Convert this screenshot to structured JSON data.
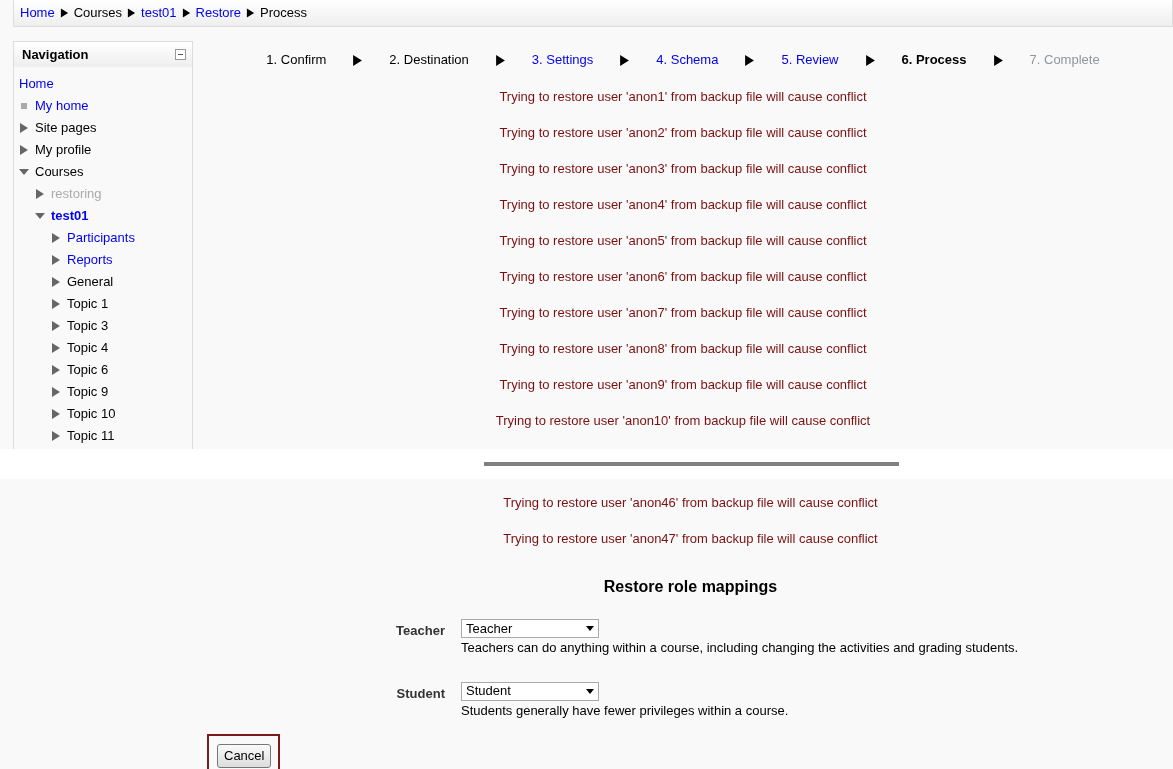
{
  "breadcrumb": [
    {
      "label": "Home",
      "link": true
    },
    {
      "label": "Courses",
      "link": false
    },
    {
      "label": "test01",
      "link": true
    },
    {
      "label": "Restore",
      "link": true
    },
    {
      "label": "Process",
      "link": false
    }
  ],
  "navigation": {
    "title": "Navigation",
    "items": [
      {
        "label": "Home",
        "kind": "none",
        "link": true
      },
      {
        "label": "My home",
        "kind": "bullet",
        "link": true
      },
      {
        "label": "Site pages",
        "kind": "branch",
        "link": false,
        "expanded": false
      },
      {
        "label": "My profile",
        "kind": "branch",
        "link": false,
        "expanded": false
      },
      {
        "label": "Courses",
        "kind": "branch",
        "link": false,
        "expanded": true,
        "children": [
          {
            "label": "restoring",
            "kind": "branch",
            "link": false,
            "disabled": true,
            "expanded": false
          },
          {
            "label": "test01",
            "kind": "branch",
            "link": true,
            "selected": true,
            "expanded": true,
            "children": [
              {
                "label": "Participants",
                "kind": "branch",
                "link": true,
                "expanded": false
              },
              {
                "label": "Reports",
                "kind": "branch",
                "link": true,
                "expanded": false
              },
              {
                "label": "General",
                "kind": "branch",
                "link": false,
                "expanded": false
              },
              {
                "label": "Topic 1",
                "kind": "branch",
                "link": false,
                "expanded": false
              },
              {
                "label": "Topic 3",
                "kind": "branch",
                "link": false,
                "expanded": false
              },
              {
                "label": "Topic 4",
                "kind": "branch",
                "link": false,
                "expanded": false
              },
              {
                "label": "Topic 6",
                "kind": "branch",
                "link": false,
                "expanded": false
              },
              {
                "label": "Topic 9",
                "kind": "branch",
                "link": false,
                "expanded": false
              },
              {
                "label": "Topic 10",
                "kind": "branch",
                "link": false,
                "expanded": false
              },
              {
                "label": "Topic 11",
                "kind": "branch",
                "link": false,
                "expanded": false
              }
            ]
          }
        ]
      }
    ]
  },
  "steps": [
    {
      "label": "1. Confirm",
      "kind": "done"
    },
    {
      "label": "2. Destination",
      "kind": "done"
    },
    {
      "label": "3. Settings",
      "kind": "link"
    },
    {
      "label": "4. Schema",
      "kind": "link"
    },
    {
      "label": "5. Review",
      "kind": "link"
    },
    {
      "label": "6. Process",
      "kind": "current"
    },
    {
      "label": "7. Complete",
      "kind": "future"
    }
  ],
  "messages_top": [
    "Trying to restore user 'anon1' from backup file will cause conflict",
    "Trying to restore user 'anon2' from backup file will cause conflict",
    "Trying to restore user 'anon3' from backup file will cause conflict",
    "Trying to restore user 'anon4' from backup file will cause conflict",
    "Trying to restore user 'anon5' from backup file will cause conflict",
    "Trying to restore user 'anon6' from backup file will cause conflict",
    "Trying to restore user 'anon7' from backup file will cause conflict",
    "Trying to restore user 'anon8' from backup file will cause conflict",
    "Trying to restore user 'anon9' from backup file will cause conflict",
    "Trying to restore user 'anon10' from backup file will cause conflict"
  ],
  "messages_bottom": [
    "Trying to restore user 'anon46' from backup file will cause conflict",
    "Trying to restore user 'anon47' from backup file will cause conflict"
  ],
  "role_mappings": {
    "title": "Restore role mappings",
    "rows": [
      {
        "label": "Teacher",
        "value": "Teacher",
        "description": "Teachers can do anything within a course, including changing the activities and grading students."
      },
      {
        "label": "Student",
        "value": "Student",
        "description": "Students generally have fewer privileges within a course."
      }
    ]
  },
  "cancel_button": {
    "label": "Cancel",
    "highlighted": true
  }
}
